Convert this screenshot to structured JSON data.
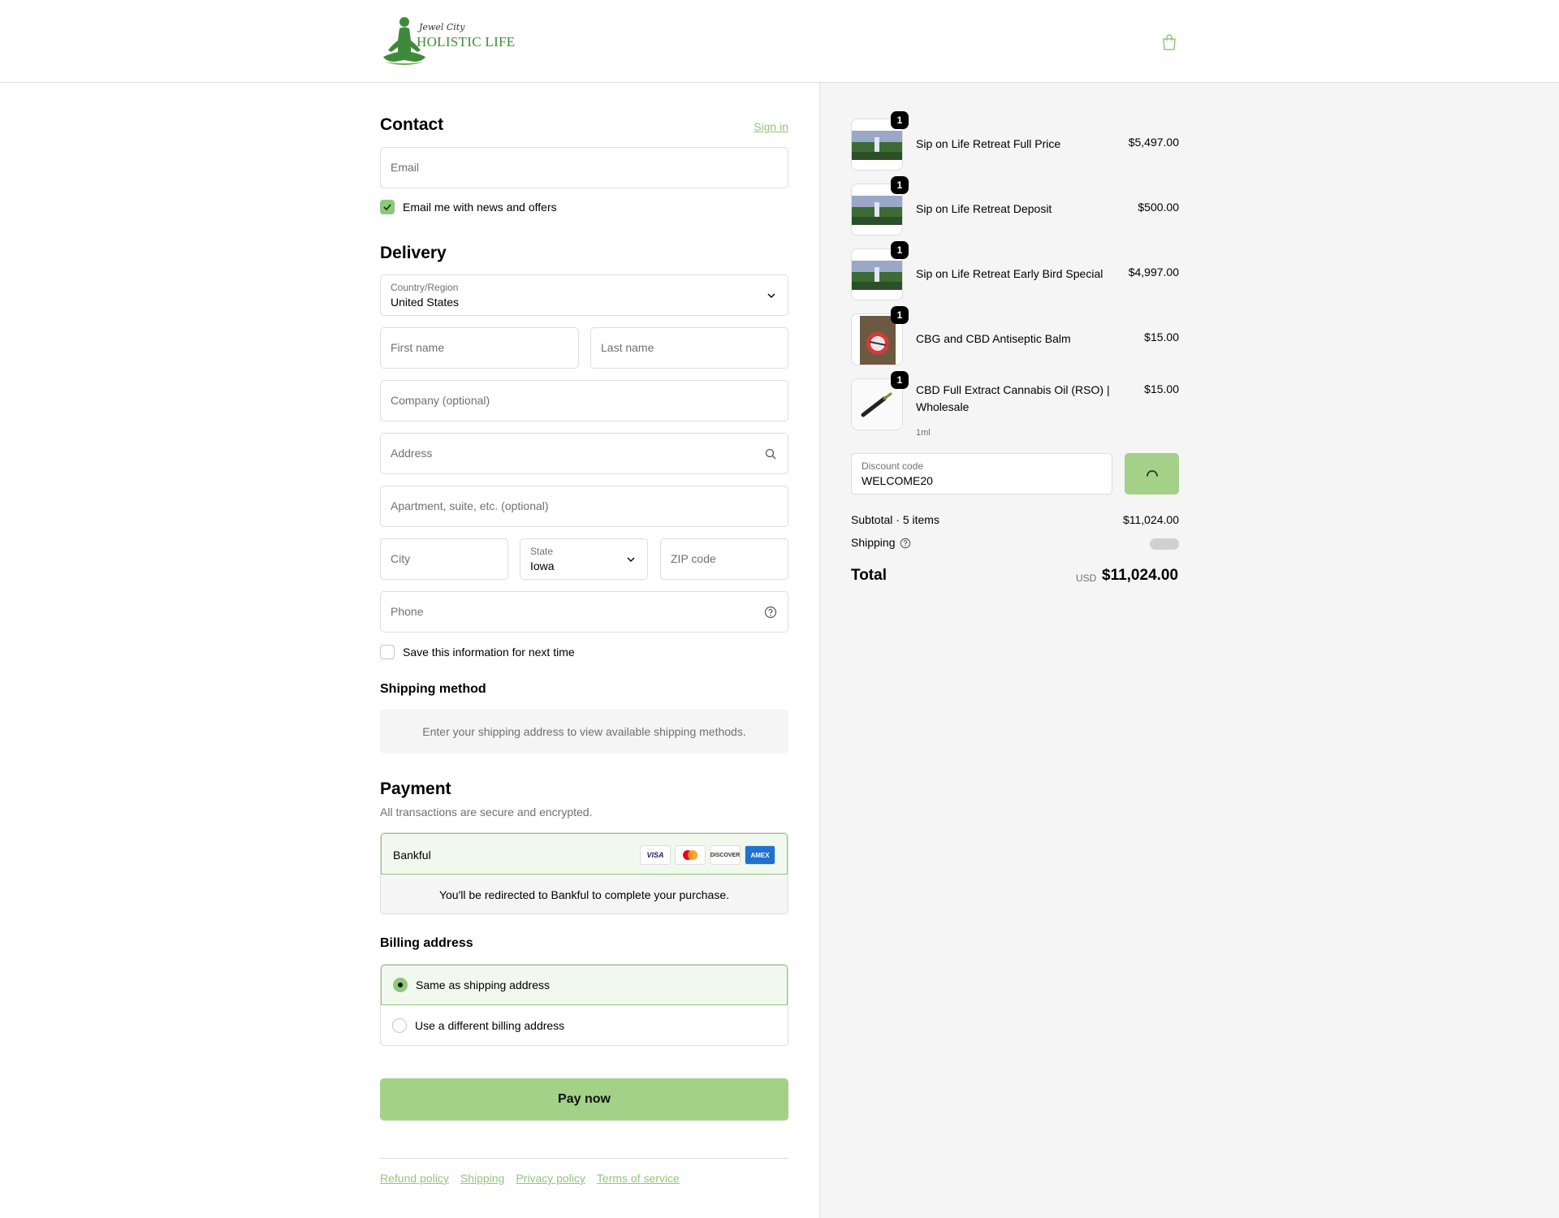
{
  "brand": {
    "logo_script": "Jewel City",
    "logo_name": "HOLISTIC LIFE",
    "accent_color": "#8fc77b",
    "button_color": "#a3d187"
  },
  "contact": {
    "title": "Contact",
    "sign_in": "Sign in",
    "email_placeholder": "Email",
    "news_label": "Email me with news and offers",
    "news_checked": true
  },
  "delivery": {
    "title": "Delivery",
    "country_label": "Country/Region",
    "country_value": "United States",
    "first_name_placeholder": "First name",
    "last_name_placeholder": "Last name",
    "company_placeholder": "Company (optional)",
    "address_placeholder": "Address",
    "apartment_placeholder": "Apartment, suite, etc. (optional)",
    "city_placeholder": "City",
    "state_label": "State",
    "state_value": "Iowa",
    "zip_placeholder": "ZIP code",
    "phone_placeholder": "Phone",
    "save_info_label": "Save this information for next time",
    "save_info_checked": false
  },
  "shipping_method": {
    "title": "Shipping method",
    "note": "Enter your shipping address to view available shipping methods."
  },
  "payment": {
    "title": "Payment",
    "subtitle": "All transactions are secure and encrypted.",
    "provider": "Bankful",
    "cards": [
      "VISA",
      "mastercard-icon",
      "DISCOVER",
      "AMEX"
    ],
    "redirect_note": "You'll be redirected to Bankful to complete your purchase."
  },
  "billing": {
    "title": "Billing address",
    "option_same": "Same as shipping address",
    "option_different": "Use a different billing address",
    "selected": "same"
  },
  "pay_now_label": "Pay now",
  "footer": {
    "links": [
      "Refund policy",
      "Shipping",
      "Privacy policy",
      "Terms of service"
    ]
  },
  "order": {
    "items": [
      {
        "name": "Sip on Life Retreat Full Price",
        "price": "$5,497.00",
        "qty": "1",
        "variant": ""
      },
      {
        "name": "Sip on Life Retreat Deposit",
        "price": "$500.00",
        "qty": "1",
        "variant": ""
      },
      {
        "name": "Sip on Life Retreat Early Bird Special",
        "price": "$4,997.00",
        "qty": "1",
        "variant": ""
      },
      {
        "name": "CBG and CBD Antiseptic Balm",
        "price": "$15.00",
        "qty": "1",
        "variant": ""
      },
      {
        "name": "CBD Full Extract Cannabis Oil (RSO) | Wholesale",
        "price": "$15.00",
        "qty": "1",
        "variant": "1ml"
      }
    ],
    "discount_label": "Discount code",
    "discount_value": "WELCOME20",
    "subtotal_label": "Subtotal · 5 items",
    "subtotal_value": "$11,024.00",
    "shipping_label": "Shipping",
    "total_label": "Total",
    "total_currency": "USD",
    "total_value": "$11,024.00"
  }
}
